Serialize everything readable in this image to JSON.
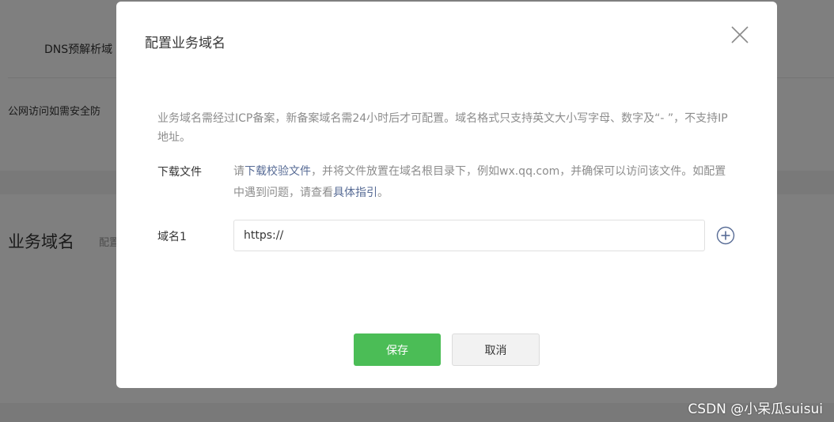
{
  "background": {
    "dns_label": "DNS预解析域",
    "public_note": "公网访问如需安全防",
    "section_title": "业务域名",
    "section_desc": "配置"
  },
  "dialog": {
    "title": "配置业务域名",
    "notice": "业务域名需经过ICP备案，新备案域名需24小时后才可配置。域名格式只支持英文大小写字母、数字及“- ”，不支持IP地址。",
    "download": {
      "label": "下载文件",
      "prefix": "请",
      "link_text": "下载校验文件",
      "middle": "，并将文件放置在域名根目录下，例如wx.qq.com，并确保可以访问该文件。如配置中遇到问题，请查看",
      "guide_link": "具体指引",
      "suffix": "。"
    },
    "domain": {
      "label": "域名1",
      "value": "https://"
    },
    "buttons": {
      "save": "保存",
      "cancel": "取消"
    }
  },
  "icons": {
    "close": "close-icon",
    "add": "add-circle-icon"
  },
  "colors": {
    "primary": "#4bbd56",
    "link": "#576b95"
  },
  "watermark": "CSDN @小呆瓜suisui"
}
